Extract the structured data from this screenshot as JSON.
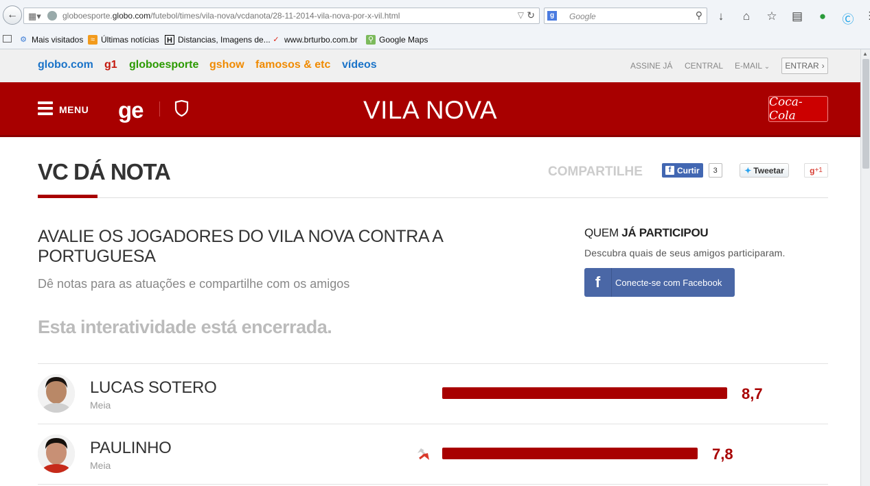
{
  "browser": {
    "url_prefix": "globoesporte.",
    "url_domain": "globo.com",
    "url_path": "/futebol/times/vila-nova/vcdanota/28-11-2014-vila-nova-por-x-vil.html",
    "search_placeholder": "Google",
    "bookmarks": [
      {
        "label": "Mais visitados"
      },
      {
        "label": "Últimas notícias"
      },
      {
        "label": "Distancias, Imagens de..."
      },
      {
        "label": "www.brturbo.com.br"
      },
      {
        "label": "Google Maps"
      }
    ]
  },
  "globonav": {
    "links": [
      {
        "label": "globo.com",
        "color": "#1a73c8"
      },
      {
        "label": "g1",
        "color": "#c4170c"
      },
      {
        "label": "globoesporte",
        "color": "#2b9a00"
      },
      {
        "label": "gshow",
        "color": "#f08a00"
      },
      {
        "label": "famosos & etc",
        "color": "#f08a00"
      },
      {
        "label": "vídeos",
        "color": "#1a73c8"
      }
    ],
    "assine": "ASSINE JÁ",
    "central": "CENTRAL",
    "email": "E-MAIL",
    "entrar": "ENTRAR"
  },
  "header": {
    "menu_label": "MENU",
    "logo": "ge",
    "team": "VILA NOVA",
    "sponsor": "Coca-Cola",
    "brand_color": "#a80000"
  },
  "page": {
    "title": "VC DÁ NOTA",
    "share_label": "COMPARTILHE",
    "fb_like_label": "Curtir",
    "fb_like_count": "3",
    "tweet_label": "Tweetar",
    "gplus_label": "+1",
    "headline": "AVALIE OS JOGADORES DO VILA NOVA CONTRA A PORTUGUESA",
    "subline": "Dê notas para as atuações e compartilhe com os amigos",
    "closed_notice": "Esta interatividade está encerrada.",
    "quem_prefix": "QUEM ",
    "quem_bold": "JÁ PARTICIPOU",
    "descubra": "Descubra quais de seus amigos participaram.",
    "fb_connect_label": "Conecte-se com Facebook"
  },
  "players": [
    {
      "name": "LUCAS SOTERO",
      "position": "Meia",
      "score": "8,7",
      "score_value": 8.7,
      "trend": "none"
    },
    {
      "name": "PAULINHO",
      "position": "Meia",
      "score": "7,8",
      "score_value": 7.8,
      "trend": "down"
    }
  ]
}
